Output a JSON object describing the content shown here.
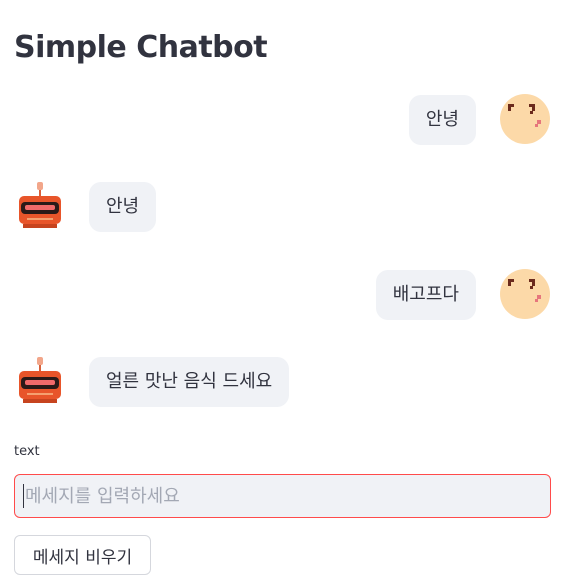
{
  "app": {
    "title": "Simple Chatbot"
  },
  "messages": [
    {
      "role": "user",
      "text": "안녕"
    },
    {
      "role": "bot",
      "text": "안녕"
    },
    {
      "role": "user",
      "text": "배고프다"
    },
    {
      "role": "bot",
      "text": "얼른 맛난 음식 드세요"
    }
  ],
  "input": {
    "label": "text",
    "placeholder": "메세지를 입력하세요",
    "value": ""
  },
  "clear_button": {
    "label": "메세지 비우기"
  },
  "icons": {
    "user_avatar": "user-face-avatar-icon",
    "bot_avatar": "robot-avatar-icon"
  },
  "colors": {
    "bubble": "#f0f2f6",
    "input_border_focus": "#ff4b4b",
    "text": "#31333f"
  }
}
